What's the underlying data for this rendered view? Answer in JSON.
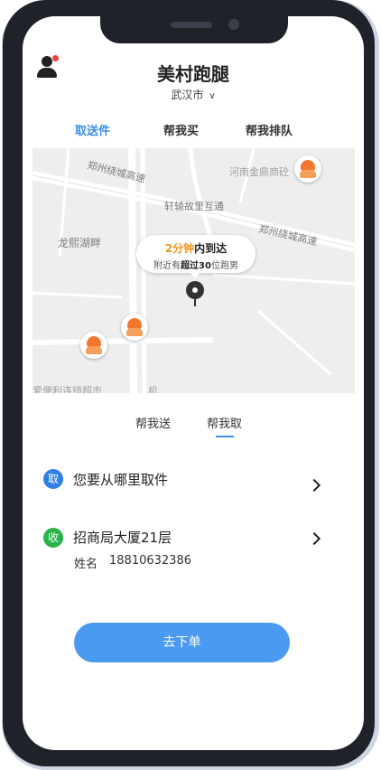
{
  "header": {
    "title": "美村跑腿",
    "city": "武汉市"
  },
  "tabs": [
    {
      "label": "取送件",
      "active": true
    },
    {
      "label": "帮我买"
    },
    {
      "label": "帮我排队"
    }
  ],
  "map": {
    "road_labels": [
      "郑州绕城高速",
      "轩辕故里互通",
      "郑州绕城高速",
      "龙熙湖畔",
      "河南金鼎商砼",
      "爱便利连锁超市",
      "机"
    ],
    "eta": {
      "time": "2分钟",
      "suffix": "内到达",
      "prefix": "附近有",
      "count": "超过30",
      "unit": "位跑男"
    }
  },
  "subtabs": [
    {
      "label": "帮我送"
    },
    {
      "label": "帮我取",
      "active": true
    }
  ],
  "pickup": {
    "badge": "取",
    "text": "您要从哪里取件"
  },
  "receive": {
    "badge": "收",
    "text": "招商局大厦21层",
    "name_label": "姓名",
    "phone": "18810632386"
  },
  "order_button": "去下单",
  "colors": {
    "accent": "#3b8fe8",
    "pickup_badge": "#2f7fe6",
    "receive_badge": "#29b34a",
    "eta_highlight": "#f0961e"
  }
}
